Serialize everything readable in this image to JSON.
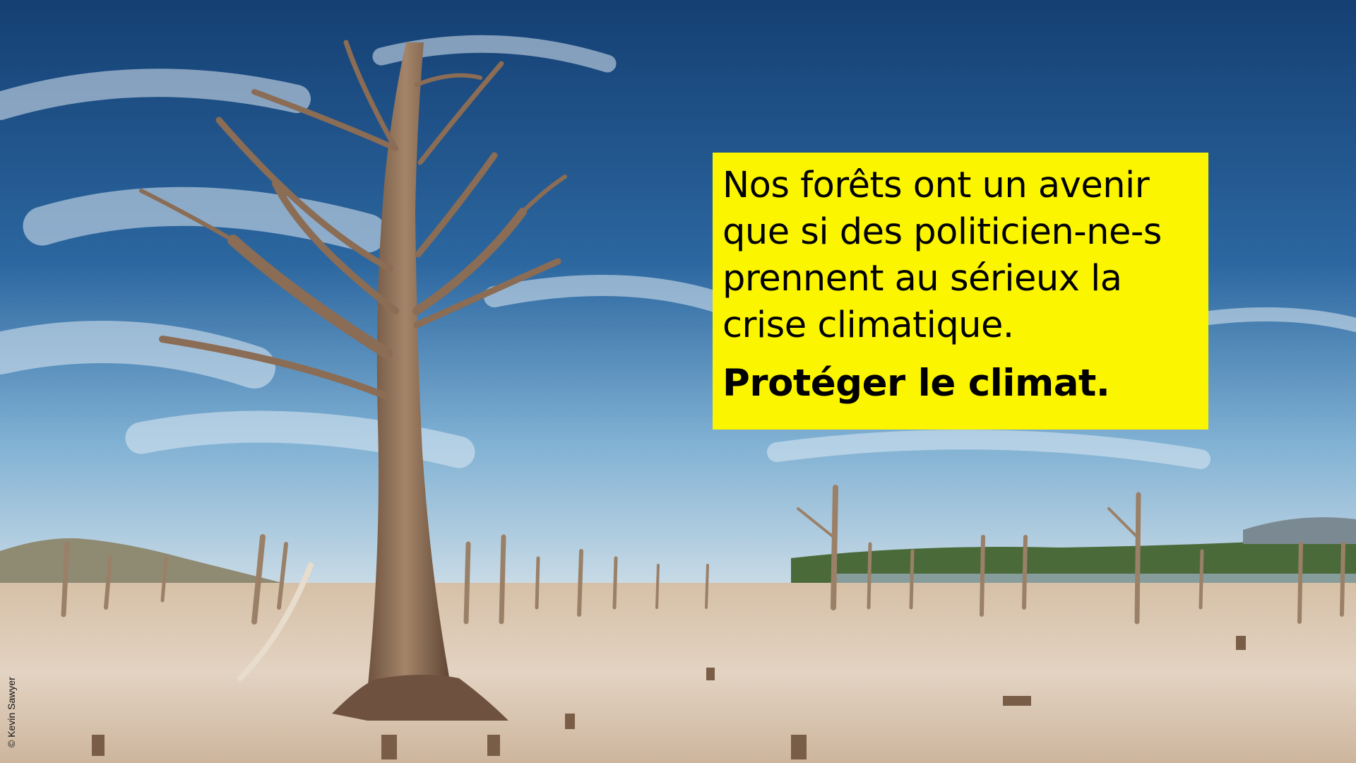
{
  "poster": {
    "main_text": "Nos forêts ont un avenir\nque si des politicien-ne-s\nprennent au sérieux la\ncrise climatique.",
    "slogan": "Protéger le climat.",
    "box_color": "#fbf500"
  },
  "photo": {
    "credit": "© Kevin Sawyer",
    "subject": "dead-tree-drought-landscape"
  },
  "colors": {
    "sky_top": "#143f73",
    "sky_mid": "#2c67a0",
    "sky_horizon": "#7fb0d3",
    "ground": "#d9c5b0",
    "wood": "#8a6a52"
  }
}
